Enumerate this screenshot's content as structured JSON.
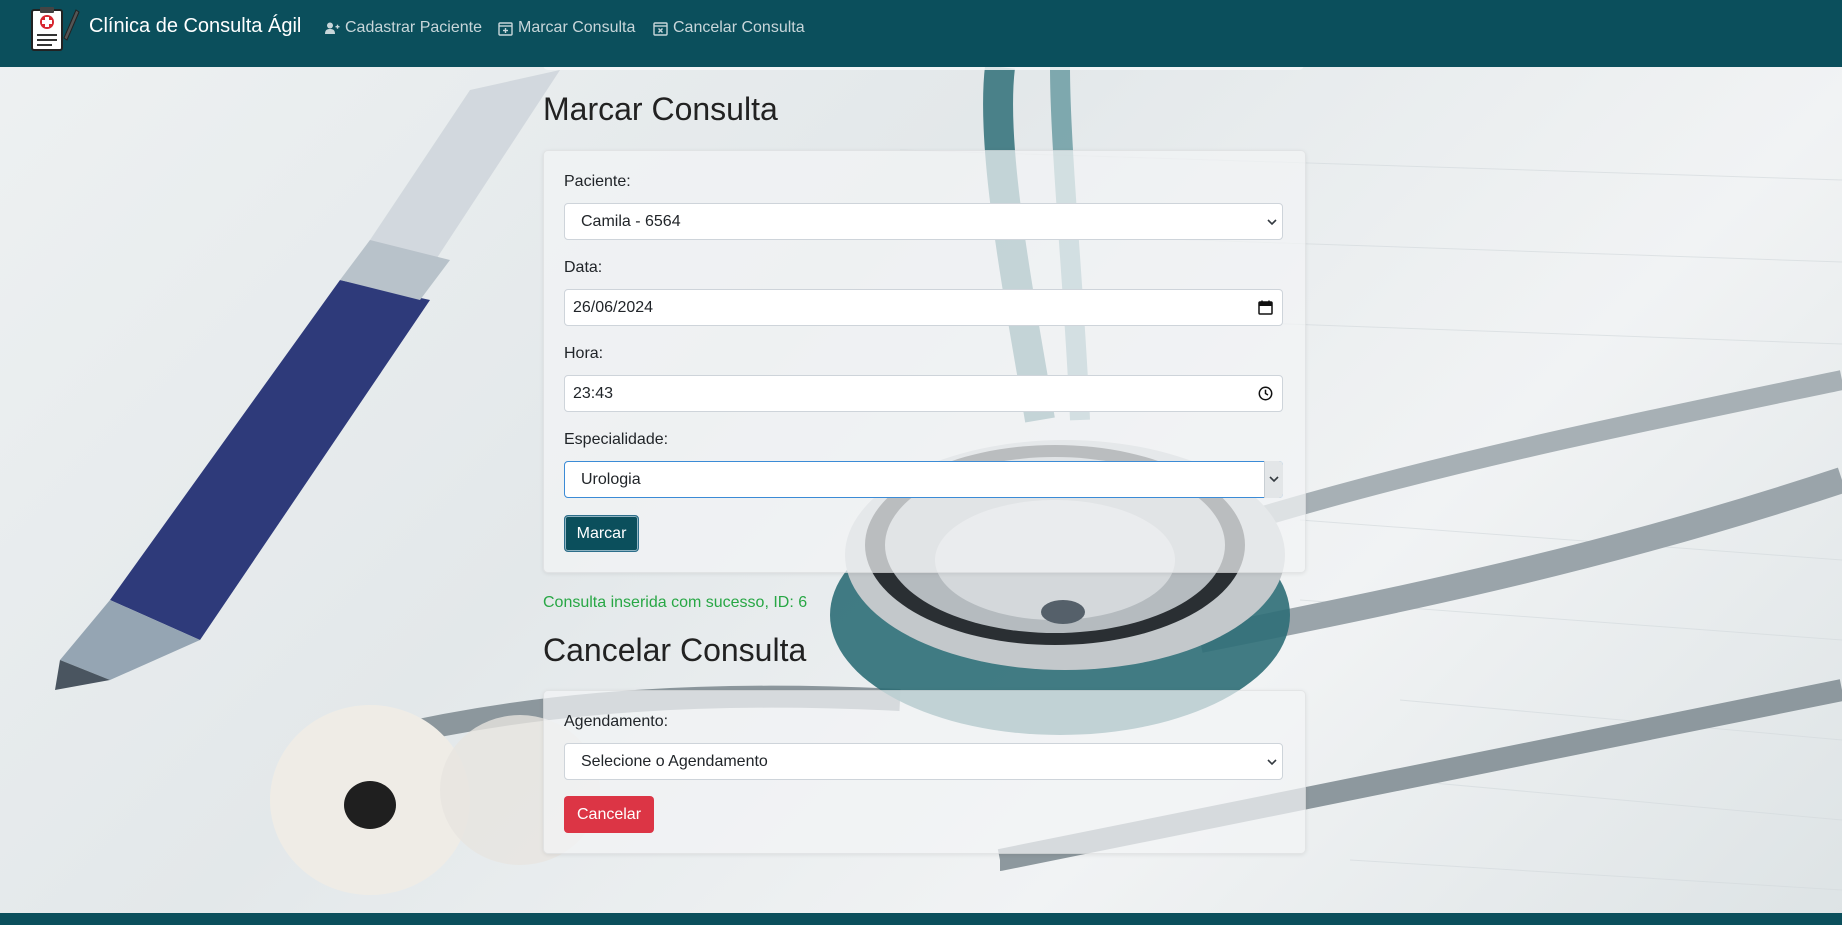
{
  "navbar": {
    "brand": "Clínica de Consulta Ágil",
    "links": [
      {
        "label": "Cadastrar Paciente",
        "icon": "user-plus-icon"
      },
      {
        "label": "Marcar Consulta",
        "icon": "calendar-plus-icon"
      },
      {
        "label": "Cancelar Consulta",
        "icon": "calendar-x-icon"
      }
    ]
  },
  "marcar": {
    "title": "Marcar Consulta",
    "paciente_label": "Paciente:",
    "paciente_value": "Camila - 6564",
    "data_label": "Data:",
    "data_value": "26/06/2024",
    "hora_label": "Hora:",
    "hora_value": "23:43",
    "especialidade_label": "Especialidade:",
    "especialidade_value": "Urologia",
    "submit_label": "Marcar"
  },
  "success_message": "Consulta inserida com sucesso, ID: 6",
  "cancelar": {
    "title": "Cancelar Consulta",
    "agendamento_label": "Agendamento:",
    "agendamento_value": "Selecione o Agendamento",
    "submit_label": "Cancelar"
  },
  "colors": {
    "navbar": "#0b4f5c",
    "primary": "#0b4f5c",
    "danger": "#dc3545",
    "success": "#28a745"
  }
}
